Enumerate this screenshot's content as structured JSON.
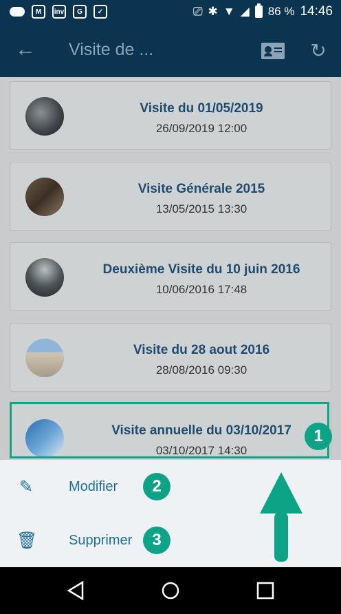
{
  "status_bar": {
    "battery_percent": "86 %",
    "time": "14:46",
    "app_icons": [
      "cloud-icon",
      "m-app-icon",
      "inv-icon",
      "g-app-icon",
      "check-app-icon"
    ]
  },
  "app_bar": {
    "title": "Visite de ...",
    "icons": [
      "back-arrow-icon",
      "contact-card-icon",
      "refresh-icon"
    ]
  },
  "visits": [
    {
      "title": "Visite du 01/05/2019",
      "datetime": "26/09/2019 12:00"
    },
    {
      "title": "Visite Générale 2015",
      "datetime": "13/05/2015 13:30"
    },
    {
      "title": "Deuxième Visite du 10 juin 2016",
      "datetime": "10/06/2016 17:48"
    },
    {
      "title": "Visite du 28 aout 2016",
      "datetime": "28/08/2016 09:30"
    },
    {
      "title": "Visite annuelle du 03/10/2017",
      "datetime": "03/10/2017 14:30"
    }
  ],
  "bottom_sheet": {
    "modify_label": "Modifier",
    "delete_label": "Supprimer"
  },
  "callouts": {
    "one": "1",
    "two": "2",
    "three": "3"
  },
  "colors": {
    "app_bar": "#0b3451",
    "accent": "#0da386",
    "title_text": "#1f4b6e",
    "sheet_text": "#1f6ea1"
  }
}
